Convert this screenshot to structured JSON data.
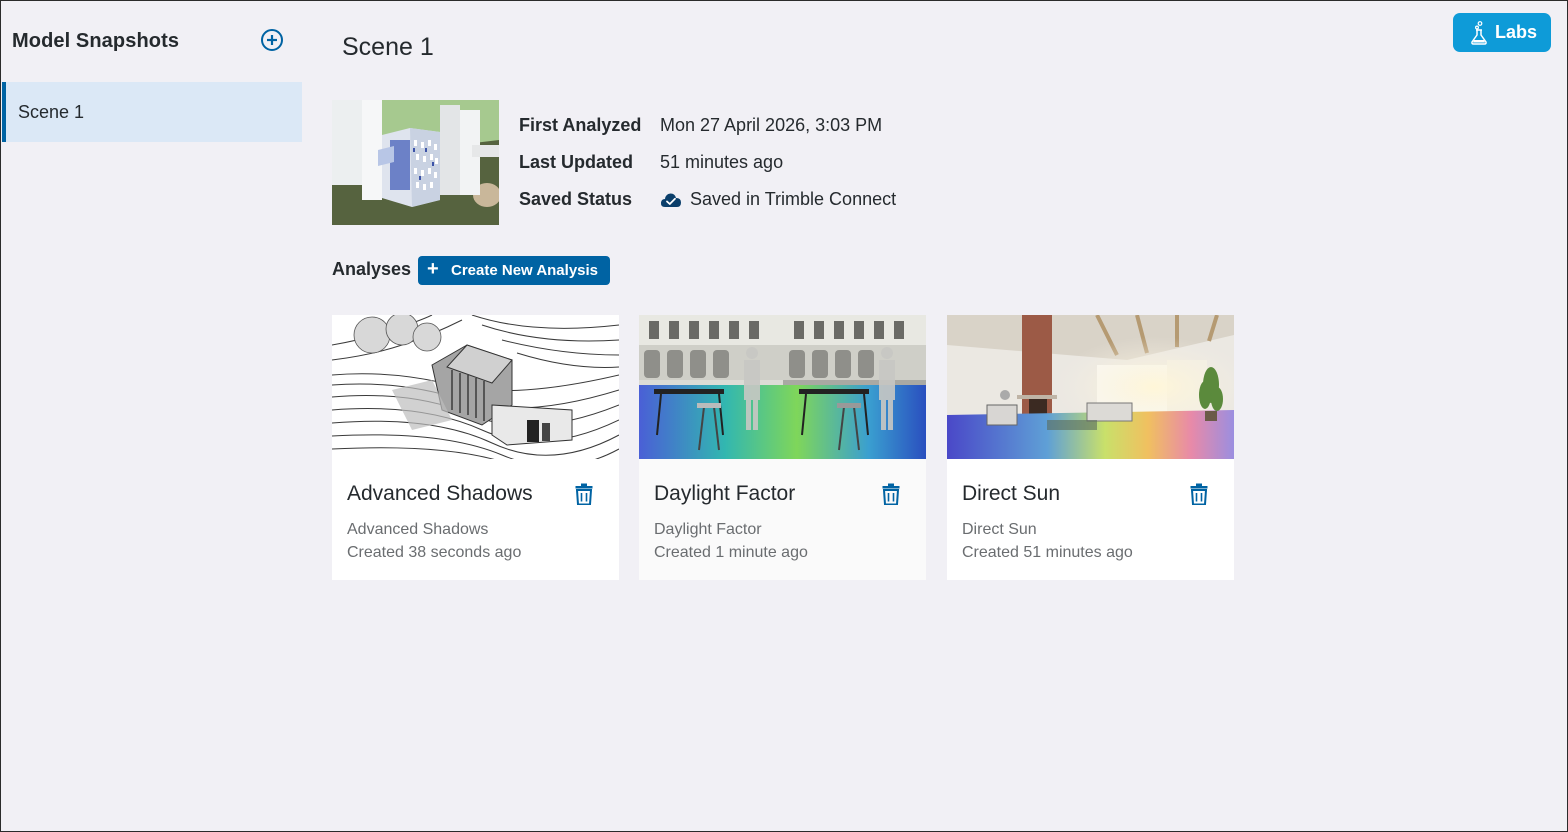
{
  "sidebar": {
    "title": "Model Snapshots",
    "add_icon": "plus-circle-icon",
    "items": [
      {
        "label": "Scene 1",
        "selected": true
      }
    ]
  },
  "labs": {
    "label": "Labs",
    "icon": "flask-icon"
  },
  "scene": {
    "title": "Scene 1",
    "info": {
      "first_analyzed_label": "First Analyzed",
      "first_analyzed_value": "Mon 27 April 2026, 3:03 PM",
      "last_updated_label": "Last Updated",
      "last_updated_value": "51 minutes ago",
      "saved_status_label": "Saved Status",
      "saved_status_value": "Saved in Trimble Connect",
      "saved_status_icon": "cloud-check-icon"
    }
  },
  "analyses": {
    "label": "Analyses",
    "create_button": "Create New Analysis",
    "cards": [
      {
        "title": "Advanced Shadows",
        "type": "Advanced Shadows",
        "created": "Created 38 seconds ago"
      },
      {
        "title": "Daylight Factor",
        "type": "Daylight Factor",
        "created": "Created 1 minute ago"
      },
      {
        "title": "Direct Sun",
        "type": "Direct Sun",
        "created": "Created 51 minutes ago"
      }
    ]
  },
  "colors": {
    "primary": "#0063a3",
    "labs": "#0e9bd8",
    "selected_bg": "#dbe8f6",
    "page_bg": "#f1f0f5"
  }
}
